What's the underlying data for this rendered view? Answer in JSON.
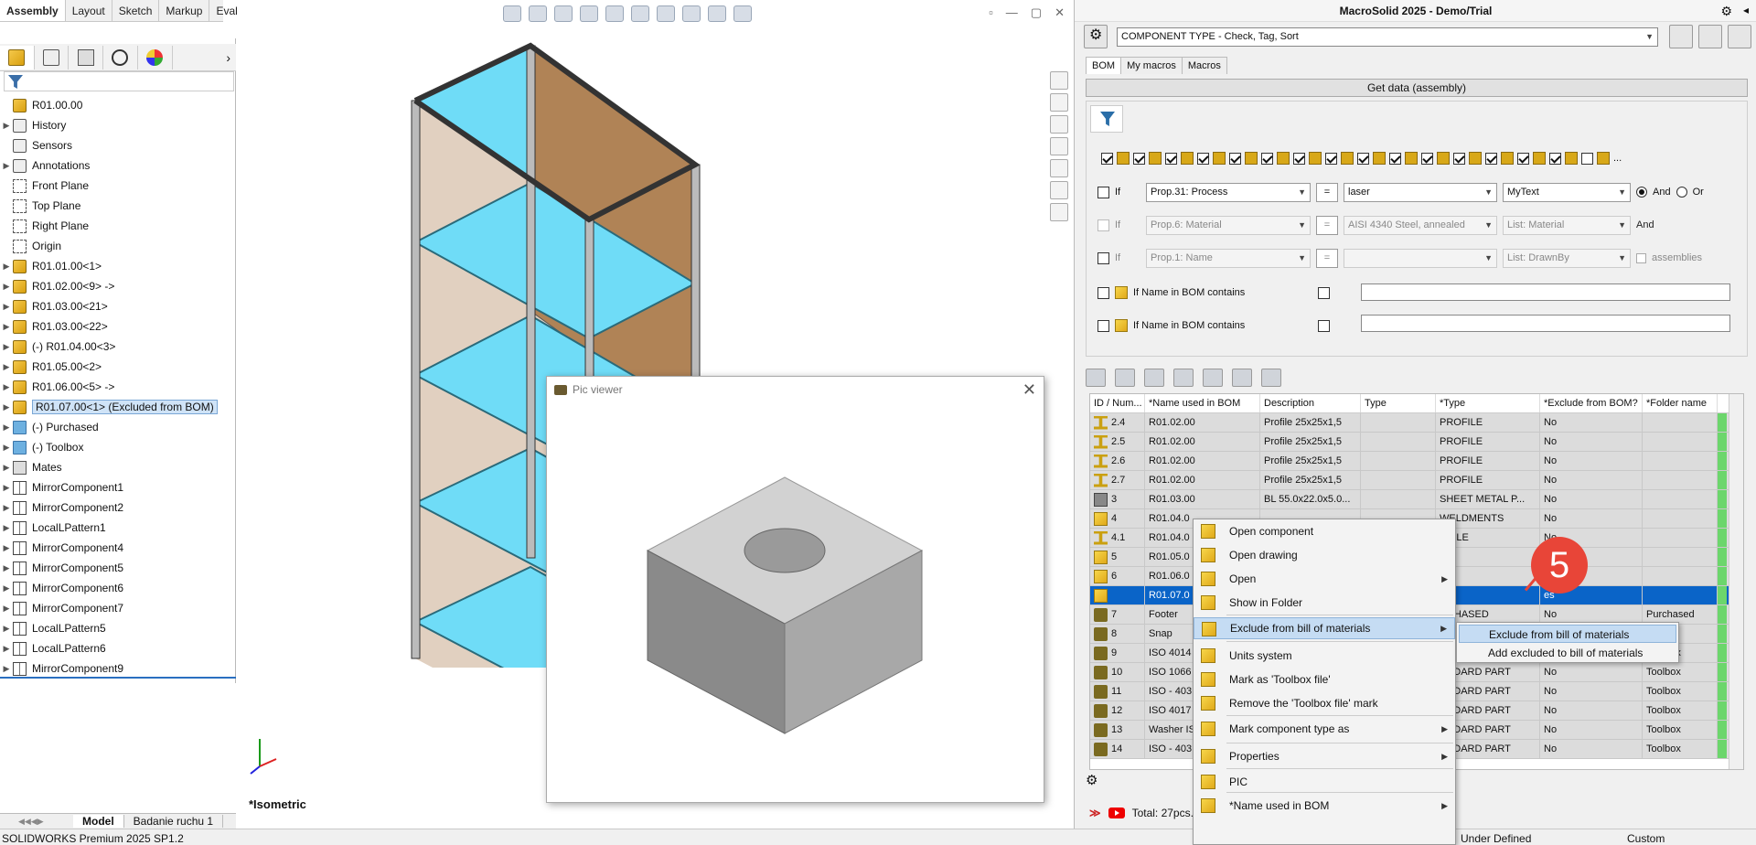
{
  "command_tabs": [
    "Assembly",
    "Layout",
    "Sketch",
    "Markup",
    "Evaluate"
  ],
  "tree": {
    "rows": [
      {
        "label": "R01.00.00",
        "icon": "assembly-icon",
        "exp": ""
      },
      {
        "label": "History",
        "icon": "history-icon",
        "exp": "▶"
      },
      {
        "label": "Sensors",
        "icon": "sensor-icon",
        "exp": ""
      },
      {
        "label": "Annotations",
        "icon": "annotation-icon",
        "exp": "▶"
      },
      {
        "label": "Front Plane",
        "icon": "plane-icon",
        "exp": ""
      },
      {
        "label": "Top Plane",
        "icon": "plane-icon",
        "exp": ""
      },
      {
        "label": "Right Plane",
        "icon": "plane-icon",
        "exp": ""
      },
      {
        "label": "Origin",
        "icon": "origin-icon",
        "exp": ""
      },
      {
        "label": "R01.01.00<1>",
        "icon": "subassembly-icon",
        "exp": "▶"
      },
      {
        "label": "R01.02.00<9> ->",
        "icon": "subassembly-icon",
        "exp": "▶"
      },
      {
        "label": "R01.03.00<21>",
        "icon": "subassembly-icon",
        "exp": "▶"
      },
      {
        "label": "R01.03.00<22>",
        "icon": "subassembly-icon",
        "exp": "▶"
      },
      {
        "label": "(-) R01.04.00<3>",
        "icon": "subassembly-icon",
        "exp": "▶"
      },
      {
        "label": "R01.05.00<2>",
        "icon": "subassembly-icon",
        "exp": "▶"
      },
      {
        "label": "R01.06.00<5> ->",
        "icon": "subassembly-icon",
        "exp": "▶"
      },
      {
        "label": "R01.07.00<1> (Excluded from BOM)",
        "icon": "subassembly-icon",
        "exp": "▶"
      },
      {
        "label": "(-) Purchased",
        "icon": "folder-icon",
        "exp": "▶"
      },
      {
        "label": "(-) Toolbox",
        "icon": "folder-icon",
        "exp": "▶"
      },
      {
        "label": "Mates",
        "icon": "mates-icon",
        "exp": "▶"
      },
      {
        "label": "MirrorComponent1",
        "icon": "mirror-icon",
        "exp": "▶"
      },
      {
        "label": "MirrorComponent2",
        "icon": "mirror-icon",
        "exp": "▶"
      },
      {
        "label": "LocalLPattern1",
        "icon": "pattern-icon",
        "exp": "▶"
      },
      {
        "label": "MirrorComponent4",
        "icon": "mirror-icon",
        "exp": "▶"
      },
      {
        "label": "MirrorComponent5",
        "icon": "mirror-icon",
        "exp": "▶"
      },
      {
        "label": "MirrorComponent6",
        "icon": "mirror-icon",
        "exp": "▶"
      },
      {
        "label": "MirrorComponent7",
        "icon": "mirror-icon",
        "exp": "▶"
      },
      {
        "label": "LocalLPattern5",
        "icon": "pattern-icon",
        "exp": "▶"
      },
      {
        "label": "LocalLPattern6",
        "icon": "pattern-icon",
        "exp": "▶"
      },
      {
        "label": "MirrorComponent9",
        "icon": "mirror-icon",
        "exp": "▶"
      }
    ]
  },
  "bottom_tabs": [
    "Model",
    "Badanie ruchu 1"
  ],
  "status": {
    "app": "SOLIDWORKS Premium 2025 SP1.2",
    "state": "Under Defined",
    "mode": "Custom"
  },
  "viewport": {
    "view_label": "*Isometric"
  },
  "pic_viewer": {
    "title": "Pic viewer"
  },
  "macrosolid": {
    "title": "MacroSolid 2025 - Demo/Trial",
    "combo": "COMPONENT TYPE - Check, Tag, Sort",
    "tabs": [
      "BOM",
      "My macros",
      "Macros"
    ],
    "get_data": "Get data (assembly)",
    "conditions": [
      {
        "if": "If",
        "prop": "Prop.31: Process",
        "eq": "=",
        "value": "laser",
        "list": "MyText",
        "and": "And",
        "or": "Or"
      },
      {
        "if": "If",
        "prop": "Prop.6: Material",
        "eq": "=",
        "value": "AISI 4340 Steel, annealed",
        "list": "List: Material",
        "and": "And"
      },
      {
        "if": "If",
        "prop": "Prop.1: Name",
        "eq": "=",
        "value": "",
        "list": "List: DrawnBy",
        "extra": "assemblies"
      }
    ],
    "name_contains": [
      "If Name in BOM contains",
      "If Name in BOM contains"
    ],
    "grid": {
      "headers": [
        "ID / Num...",
        "*Name used in BOM",
        "Description",
        "Type",
        "*Type",
        "*Exclude from BOM?",
        "*Folder name"
      ],
      "rows": [
        {
          "id": "2.4",
          "name": "R01.02.00",
          "desc": "Profile 25x25x1,5",
          "type": "",
          "ptype": "PROFILE",
          "excl": "No",
          "folder": "",
          "icon": "beam"
        },
        {
          "id": "2.5",
          "name": "R01.02.00",
          "desc": "Profile 25x25x1,5",
          "type": "",
          "ptype": "PROFILE",
          "excl": "No",
          "folder": "",
          "icon": "beam"
        },
        {
          "id": "2.6",
          "name": "R01.02.00",
          "desc": "Profile 25x25x1,5",
          "type": "",
          "ptype": "PROFILE",
          "excl": "No",
          "folder": "",
          "icon": "beam"
        },
        {
          "id": "2.7",
          "name": "R01.02.00",
          "desc": "Profile 25x25x1,5",
          "type": "",
          "ptype": "PROFILE",
          "excl": "No",
          "folder": "",
          "icon": "beam"
        },
        {
          "id": "3",
          "name": "R01.03.00",
          "desc": "BL 55.0x22.0x5.0...",
          "type": "",
          "ptype": "SHEET METAL P...",
          "excl": "No",
          "folder": "",
          "icon": "sheet"
        },
        {
          "id": "4",
          "name": "R01.04.0",
          "desc": "",
          "type": "",
          "ptype": "WELDMENTS",
          "excl": "No",
          "folder": "",
          "icon": "part"
        },
        {
          "id": "4.1",
          "name": "R01.04.0",
          "desc": "",
          "type": "",
          "ptype": "OFILE",
          "excl": "No",
          "folder": "",
          "icon": "beam"
        },
        {
          "id": "5",
          "name": "R01.05.0",
          "desc": "",
          "type": "",
          "ptype": "RT",
          "excl": "No",
          "folder": "",
          "icon": "part"
        },
        {
          "id": "6",
          "name": "R01.06.0",
          "desc": "",
          "type": "",
          "ptype": "RT",
          "excl": "No",
          "folder": "",
          "icon": "part"
        },
        {
          "id": "",
          "name": "R01.07.0",
          "desc": "",
          "type": "",
          "ptype": "RT",
          "excl": "es",
          "folder": "",
          "icon": "part",
          "sel": true
        },
        {
          "id": "7",
          "name": "Footer",
          "desc": "",
          "type": "",
          "ptype": "RCHASED",
          "excl": "No",
          "folder": "Purchased",
          "icon": "std"
        },
        {
          "id": "8",
          "name": "Snap",
          "desc": "",
          "type": "",
          "ptype": "RCHASED",
          "excl": "No",
          "folder": "ed",
          "icon": "std"
        },
        {
          "id": "9",
          "name": "ISO 4014",
          "desc": "",
          "type": "",
          "ptype": "ANDARD PART",
          "excl": "No",
          "folder": "Toolbox",
          "icon": "std"
        },
        {
          "id": "10",
          "name": "ISO 1066",
          "desc": "",
          "type": "",
          "ptype": "ANDARD PART",
          "excl": "No",
          "folder": "Toolbox",
          "icon": "std"
        },
        {
          "id": "11",
          "name": "ISO - 403",
          "desc": "",
          "type": "",
          "ptype": "ANDARD PART",
          "excl": "No",
          "folder": "Toolbox",
          "icon": "std"
        },
        {
          "id": "12",
          "name": "ISO 4017",
          "desc": "",
          "type": "",
          "ptype": "ANDARD PART",
          "excl": "No",
          "folder": "Toolbox",
          "icon": "std"
        },
        {
          "id": "13",
          "name": "Washer IS",
          "desc": "",
          "type": "",
          "ptype": "ANDARD PART",
          "excl": "No",
          "folder": "Toolbox",
          "icon": "std"
        },
        {
          "id": "14",
          "name": "ISO - 403",
          "desc": "",
          "type": "",
          "ptype": "ANDARD PART",
          "excl": "No",
          "folder": "Toolbox",
          "icon": "std"
        }
      ]
    },
    "total": "Total: 27pcs."
  },
  "context_menu": {
    "items": [
      {
        "label": "Open component",
        "icon": "open-component-icon",
        "arrow": false
      },
      {
        "label": "Open drawing",
        "icon": "open-drawing-icon",
        "arrow": false
      },
      {
        "label": "Open",
        "icon": "open-arrow-icon",
        "arrow": true
      },
      {
        "label": "Show in Folder",
        "icon": "folder-icon",
        "arrow": false
      },
      {
        "label": "Exclude from bill of materials",
        "icon": "bom-icon",
        "arrow": true,
        "hl": true
      },
      {
        "label": "Units system",
        "icon": "units-icon",
        "arrow": false
      },
      {
        "label": "Mark as 'Toolbox file'",
        "icon": "toolbox-icon",
        "arrow": false
      },
      {
        "label": "Remove the 'Toolbox file' mark",
        "icon": "toolbox-remove-icon",
        "arrow": false
      },
      {
        "label": "Mark component type as",
        "icon": "filter-icon",
        "arrow": true
      },
      {
        "label": "Properties",
        "icon": "properties-icon",
        "arrow": true
      },
      {
        "label": "PIC",
        "icon": "camera-icon",
        "arrow": false
      },
      {
        "label": "*Name used in BOM",
        "icon": "name-icon",
        "arrow": true
      }
    ]
  },
  "submenu": {
    "items": [
      "Exclude from bill of materials",
      "Add excluded to bill of materials"
    ]
  },
  "callout": {
    "number": "5"
  }
}
